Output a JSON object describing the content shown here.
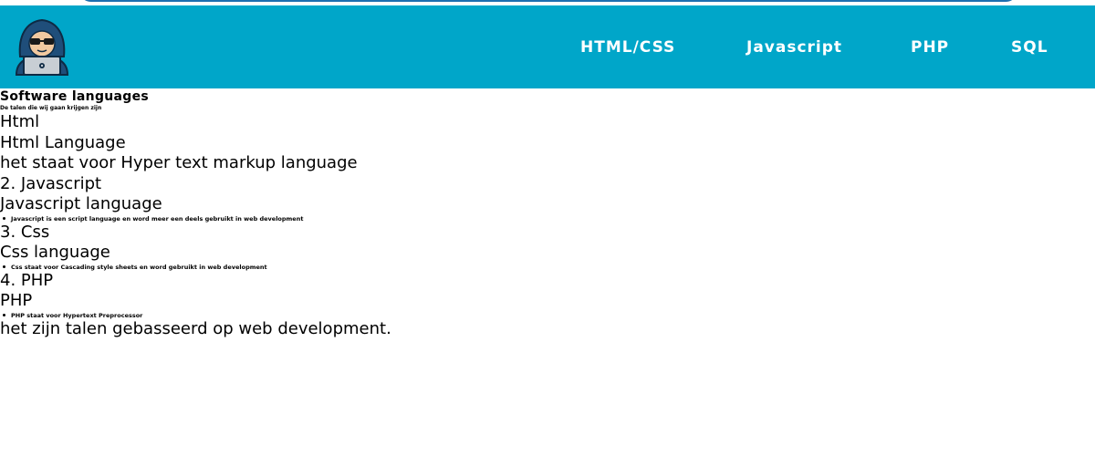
{
  "nav": {
    "links": [
      "HTML/CSS",
      "Javascript",
      "PHP",
      "SQL"
    ]
  },
  "main": {
    "title": "Software languages",
    "subtitle": "De talen die wij gaan krijgen zijn",
    "sections": [
      {
        "heading": "Html",
        "name": "Html Language",
        "description": "het staat voor Hyper text markup language"
      },
      {
        "heading": "2. Javascript",
        "name": "Javascript language",
        "bullet": "Javascript is een script language en word meer een deels gebruikt in web development"
      },
      {
        "heading": "3. Css",
        "name": "Css language",
        "bullet": "Css staat voor Cascading style sheets en word gebruikt in web development"
      },
      {
        "heading": "4. PHP",
        "name": "PHP",
        "bullet": "PHP staat voor Hypertext Preprocessor"
      }
    ],
    "footer_text": "het zijn talen gebasseerd op web development."
  },
  "colors": {
    "navbar": "#00a6c9",
    "nav_text": "#ffffff",
    "top_pill_border": "#1d6fb0"
  },
  "icons": {
    "logo": "hacker-laptop-icon"
  }
}
